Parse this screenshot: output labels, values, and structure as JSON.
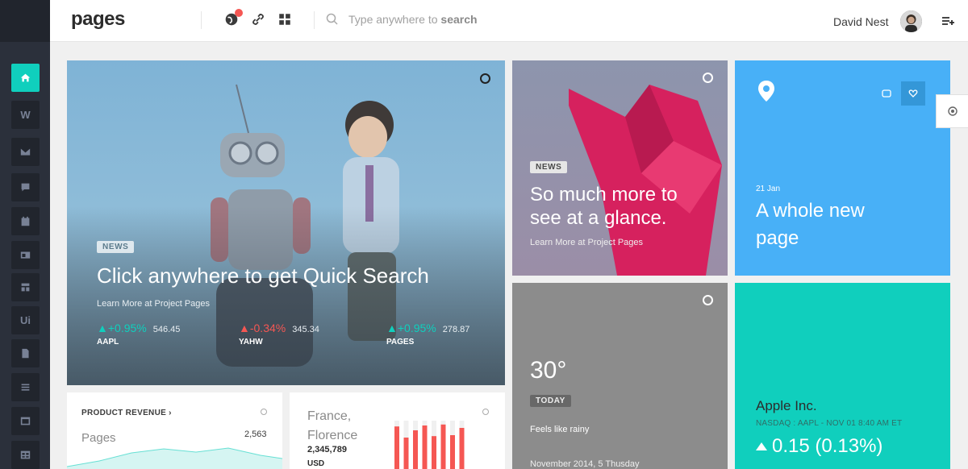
{
  "header": {
    "logo": "pages",
    "search_placeholder_prefix": "Type anywhere to ",
    "search_placeholder_bold": "search",
    "user_name": "David Nest"
  },
  "sidebar": {
    "items": [
      {
        "icon": "home-icon",
        "label": ""
      },
      {
        "icon": "w-icon",
        "label": "W"
      },
      {
        "icon": "mail-icon",
        "label": ""
      },
      {
        "icon": "chat-icon",
        "label": ""
      },
      {
        "icon": "calendar-icon",
        "label": ""
      },
      {
        "icon": "layout-icon",
        "label": ""
      },
      {
        "icon": "grid-icon",
        "label": ""
      },
      {
        "icon": "ui-icon",
        "label": "Ui"
      },
      {
        "icon": "file-icon",
        "label": ""
      },
      {
        "icon": "list-icon",
        "label": ""
      },
      {
        "icon": "window-icon",
        "label": ""
      },
      {
        "icon": "table-icon",
        "label": ""
      }
    ]
  },
  "hero": {
    "badge": "NEWS",
    "title": "Click anywhere to get Quick Search",
    "subtitle": "Learn More at Project Pages",
    "stocks": [
      {
        "change": "+0.95%",
        "price": "546.45",
        "symbol": "AAPL",
        "direction": "up"
      },
      {
        "change": "-0.34%",
        "price": "345.34",
        "symbol": "YAHW",
        "direction": "down"
      },
      {
        "change": "+0.95%",
        "price": "278.87",
        "symbol": "PAGES",
        "direction": "up"
      }
    ]
  },
  "news2": {
    "badge": "NEWS",
    "title": "So much more to see at a glance.",
    "subtitle": "Learn More at Project Pages"
  },
  "blue_tile": {
    "date": "21 Jan",
    "title_line1": "A whole new",
    "title_line2": "page"
  },
  "weather": {
    "temperature": "30°",
    "badge": "TODAY",
    "description": "Feels like rainy",
    "date": "November 2014, 5 Thusday"
  },
  "stock_tile": {
    "company": "Apple Inc.",
    "meta": "NASDAQ : AAPL - NOV 01 8:40 AM ET",
    "change": "0.15 (0.13%)"
  },
  "revenue": {
    "title": "PRODUCT REVENUE",
    "label": "Pages",
    "value": "2,563"
  },
  "city": {
    "name_line1": "France,",
    "name_line2": "Florence",
    "value": "2,345,789",
    "currency": "USD",
    "bars": [
      0.88,
      0.65,
      0.8,
      0.9,
      0.68,
      0.92,
      0.7,
      0.85
    ]
  },
  "colors": {
    "accent": "#10cfbd",
    "danger": "#f55753",
    "blue": "#48b0f7",
    "sidebar": "#2b303b"
  }
}
